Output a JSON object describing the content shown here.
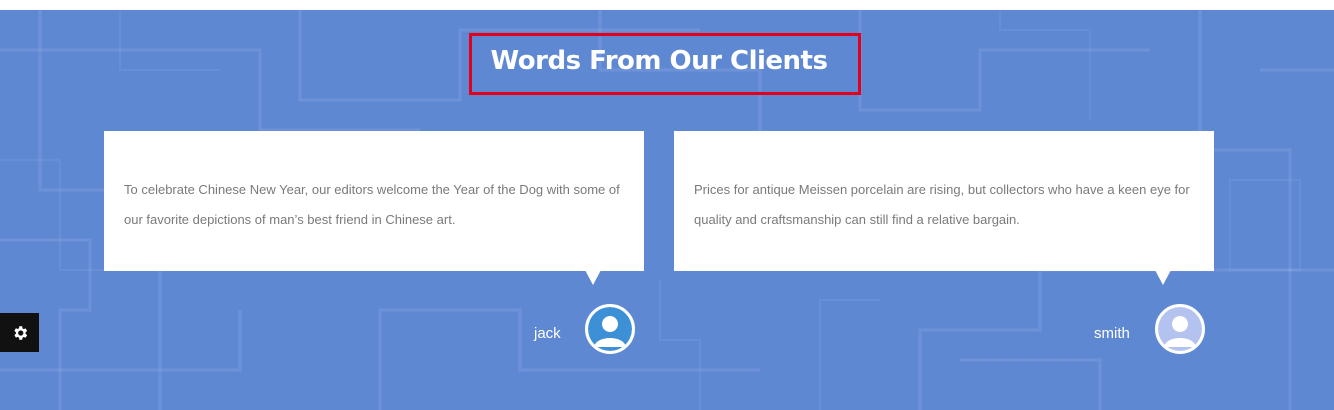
{
  "section": {
    "title": "Words From Our Clients"
  },
  "testimonials": [
    {
      "text": "To celebrate Chinese New Year, our editors welcome the Year of the Dog with some of our favorite depictions of man’s best friend in Chinese art.",
      "name": "jack",
      "avatar_icon": "user-avatar-icon"
    },
    {
      "text": "Prices for antique Meissen porcelain are rising, but collectors who have a keen eye for quality and craftsmanship can still find a relative bargain.",
      "name": "smith",
      "avatar_icon": "user-avatar-icon"
    }
  ],
  "settings": {
    "icon": "gear-icon"
  },
  "colors": {
    "background": "#5f88d3",
    "card": "#ffffff",
    "card_text": "#7a7a7a",
    "title_highlight_border": "#e3001b",
    "avatar_1": "#3d8fd6",
    "avatar_2": "#b3c2ef",
    "settings_button": "#111111"
  }
}
